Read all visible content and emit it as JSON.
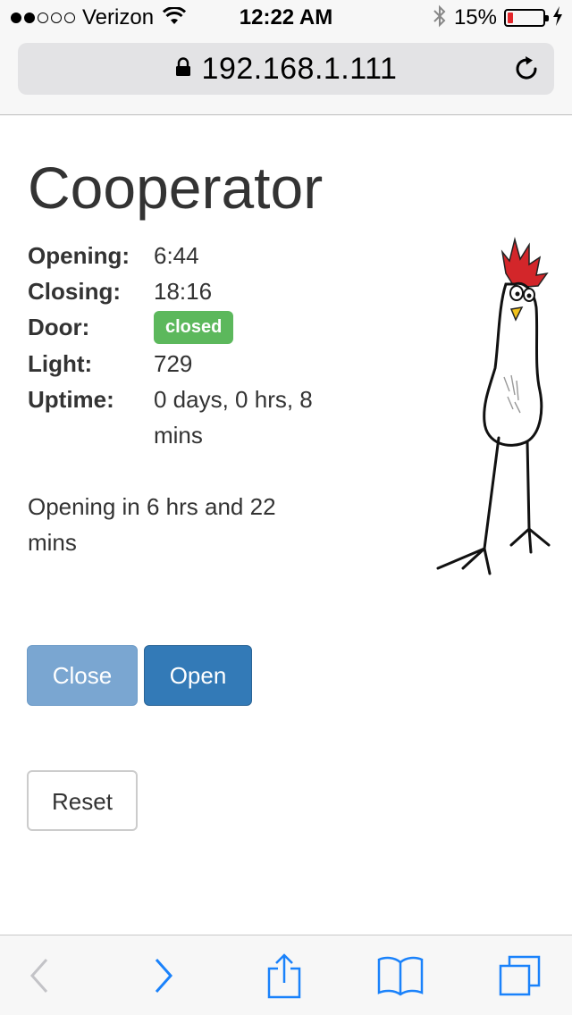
{
  "status_bar": {
    "carrier": "Verizon",
    "time": "12:22 AM",
    "battery_percent": "15%",
    "battery_level": 0.15,
    "signal_strength": 2,
    "signal_max": 5
  },
  "browser": {
    "url": "192.168.1.111",
    "icons": [
      "lock-icon",
      "reload-icon",
      "back-icon",
      "forward-icon",
      "share-icon",
      "bookmarks-icon",
      "tabs-icon"
    ]
  },
  "page": {
    "title": "Cooperator",
    "info": [
      {
        "label": "Opening:",
        "value": "6:44"
      },
      {
        "label": "Closing:",
        "value": "18:16"
      },
      {
        "label": "Door:",
        "value": "closed"
      },
      {
        "label": "Light:",
        "value": "729"
      },
      {
        "label": "Uptime:",
        "value": "0 days, 0 hrs, 8 mins"
      }
    ],
    "countdown": "Opening in 6 hrs and 22 mins",
    "buttons": {
      "close": "Close",
      "open": "Open",
      "reset": "Reset"
    },
    "image": "chicken-drawing"
  },
  "colors": {
    "badge_success": "#5cb85c",
    "primary": "#337ab7",
    "primary_disabled": "#7aa6d1",
    "ios_blue": "#1a82fb",
    "battery_low": "#e3262b"
  }
}
